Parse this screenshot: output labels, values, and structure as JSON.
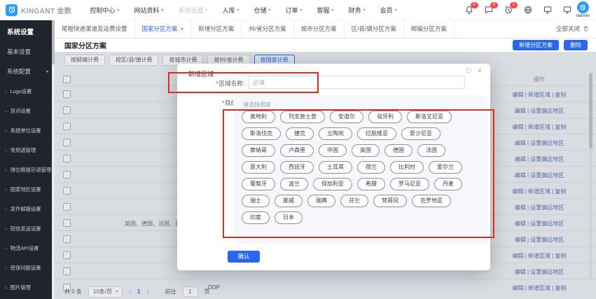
{
  "app": {
    "brand": "KINGANT 金数",
    "user": "iadmin"
  },
  "navbar": {
    "menus": [
      {
        "label": "控制中心"
      },
      {
        "label": "网站资料"
      },
      {
        "label": "系统设置",
        "muted": true
      },
      {
        "label": "入库"
      },
      {
        "label": "仓储"
      },
      {
        "label": "订单"
      },
      {
        "label": "客服"
      },
      {
        "label": "财务"
      },
      {
        "label": "会员"
      }
    ],
    "badges": {
      "bell": "0",
      "message": "0",
      "alarm": "1"
    }
  },
  "tabbar": {
    "tabs": [
      {
        "label": "尾程快递渠道及运费设置"
      },
      {
        "label": "国家分区方案",
        "active": true,
        "closable": true
      },
      {
        "label": "新增分区方案"
      },
      {
        "label": "州/省分区方案"
      },
      {
        "label": "城市分区方案"
      },
      {
        "label": "区/县/镇分区方案"
      },
      {
        "label": "邮编分区方案"
      }
    ],
    "close_all": "全部关闭"
  },
  "sidebar": {
    "title": "系统设置",
    "items": [
      {
        "label": "基本设置",
        "top": true
      },
      {
        "label": "系统配置",
        "top": true,
        "caret": true
      },
      {
        "label": "Logo设置",
        "sub": true
      },
      {
        "label": "货币设置",
        "sub": true
      },
      {
        "label": "系统单位设置",
        "sub": true
      },
      {
        "label": "常用语管理",
        "sub": true
      },
      {
        "label": "弹出框提示语管理",
        "sub": true
      },
      {
        "label": "国家地区设置",
        "sub": true
      },
      {
        "label": "发件邮箱设置",
        "sub": true
      },
      {
        "label": "短信发送设置",
        "sub": true
      },
      {
        "label": "物流API设置",
        "sub": true
      },
      {
        "label": "密保问题设置",
        "sub": true
      },
      {
        "label": "图片管理",
        "sub": true
      }
    ]
  },
  "page": {
    "title": "国家分区方案",
    "new_button": "新增分区方案",
    "delete_button": "删除",
    "subtabs": [
      {
        "label": "按邮编计费"
      },
      {
        "label": "按区/县/镇计费"
      },
      {
        "label": "按城市计费"
      },
      {
        "label": "按州/省计费"
      },
      {
        "label": "按国家计费",
        "active": true
      }
    ]
  },
  "table": {
    "op_header": "操作",
    "rows": [
      {
        "ops": "编辑 | 新增区域 | 复制"
      },
      {
        "ops": "编辑 | 设置偏远地区"
      },
      {
        "ops": "编辑 | 新增区域 | 复制"
      },
      {
        "ops": "编辑 | 设置偏远地区"
      },
      {
        "ops": "编辑 | 设置偏远地区"
      },
      {
        "ops": "编辑 | 设置偏远地区"
      },
      {
        "ops": "编辑 | 新增区域 | 复制"
      },
      {
        "ops": "编辑 | 设置偏远地区"
      },
      {
        "ops": "编辑 | 设置偏远地区",
        "cell": "英国、德国、法国、意大利"
      },
      {
        "ops": "编辑 | 设置偏远地区"
      },
      {
        "ops": "编辑 | 新增区域 | 复制"
      },
      {
        "ops": "编辑 | 设置偏远地区"
      },
      {
        "ops": "编辑 | 新增区域 | 复制",
        "cell2": "DDP"
      }
    ]
  },
  "pagination": {
    "total": "共 0 条",
    "page_size": "10条/页",
    "current": "1",
    "goto_label": "前往",
    "goto_value": "1",
    "goto_unit": "页"
  },
  "modal": {
    "title": "新增区域",
    "name_required_mark": "*",
    "name_label": "区域名称:",
    "name_placeholder": "必填",
    "dest_required_mark": "*",
    "dest_label": "目的地:",
    "picker_hint": "请选择国家",
    "country_rows": [
      [
        "奥地利",
        "列支敦士登",
        "安道尔",
        "匈牙利",
        "斯洛文尼亚"
      ],
      [
        "斯洛伐克",
        "捷克",
        "立陶宛",
        "拉脱维亚",
        "爱沙尼亚"
      ],
      [
        "摩纳哥",
        "卢森堡",
        "中国",
        "英国",
        "德国",
        "法国"
      ],
      [
        "意大利",
        "西班牙",
        "土耳其",
        "荷兰",
        "比利时",
        "爱尔兰"
      ],
      [
        "葡萄牙",
        "波兰",
        "保加利亚",
        "希腊",
        "罗马尼亚",
        "丹麦"
      ],
      [
        "瑞士",
        "挪威",
        "瑞典",
        "芬兰",
        "梵蒂冈",
        "克罗地亚"
      ],
      [
        "印度",
        "日本"
      ]
    ],
    "confirm_label": "确认"
  },
  "icons": {
    "caret_down": "▾",
    "close": "×",
    "minimize": "□",
    "sub_prefix": "∟",
    "prev": "‹",
    "next": "›"
  },
  "colors": {
    "accent": "#2a66f0",
    "annotation": "#e02a1e",
    "link": "#5a71b5"
  }
}
